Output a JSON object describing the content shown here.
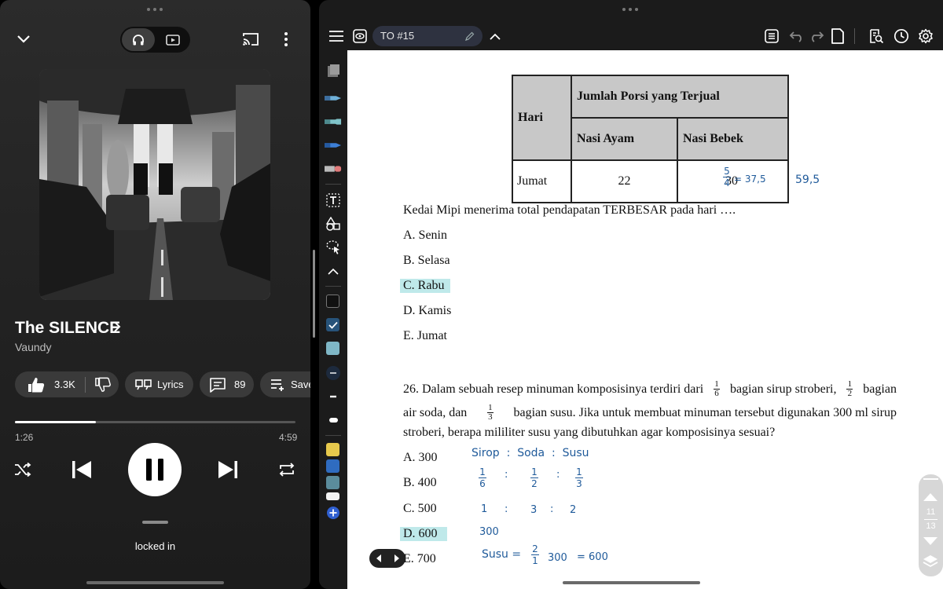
{
  "music_player": {
    "song_title": "The SILENCE",
    "artist": "Vaundy",
    "likes": "3.3K",
    "lyrics_label": "Lyrics",
    "comments": "89",
    "save_label": "Save",
    "time_current": "1:26",
    "time_total": "4:59",
    "progress": 0.288,
    "playlist_label": "locked in",
    "mode": "audio"
  },
  "notes_app": {
    "doc_title": "TO #15",
    "page_current": "11",
    "page_total": "13",
    "tool_colors": [
      "#111111",
      "#27537a",
      "#7fb7c6",
      "#e7c94c",
      "#2f6cc0",
      "#5b8c9c",
      "#f2f2f2"
    ],
    "table": {
      "col_day": "Hari",
      "col_group": "Jumlah Porsi yang Terjual",
      "col_a": "Nasi Ayam",
      "col_b": "Nasi Bebek",
      "row_day": "Jumat",
      "row_a": "22",
      "row_b": "30",
      "row_b_note_num": "5",
      "row_b_note_den": "4",
      "row_b_note_result": "= 37,5",
      "row_b_note_total": "59,5"
    },
    "q25": {
      "question": "Kedai Mipi menerima total pendapatan TERBESAR pada hari ….",
      "options": [
        "A. Senin",
        "B. Selasa",
        "C. Rabu",
        "D. Kamis",
        "E.  Jumat"
      ],
      "highlighted": "C. Rabu"
    },
    "q26": {
      "line1_a": "26. Dalam sebuah resep minuman komposisinya terdiri dari",
      "line1_b": "bagian sirup stroberi,",
      "line1_c": "bagian",
      "line2_a": "air soda, dan",
      "line2_b": "bagian susu. Jika untuk membuat minuman tersebut digunakan 300 ml sirup",
      "line3": "stroberi, berapa mililiter susu yang dibutuhkan agar komposisinya sesuai?",
      "frac1_num": "1",
      "frac1_den": "6",
      "frac2_num": "1",
      "frac2_den": "2",
      "frac3_num": "1",
      "frac3_den": "3",
      "options": [
        "A. 300",
        "B. 400",
        "C. 500",
        "D. 600",
        "E. 700"
      ],
      "highlighted": "D. 600"
    },
    "handwriting": {
      "header": "Sirop  :  Soda  :  Susu",
      "f1_num": "1",
      "f1_den": "6",
      "f2_num": "1",
      "f2_den": "2",
      "f3_num": "1",
      "f3_den": "3",
      "colon": ":",
      "ratio_1": "1",
      "ratio_2": "3",
      "ratio_3": "2",
      "value": "300",
      "susu_label": "Susu =",
      "s_num": "2",
      "s_den": "1",
      "s_mult": "300",
      "s_result": "= 600"
    }
  }
}
